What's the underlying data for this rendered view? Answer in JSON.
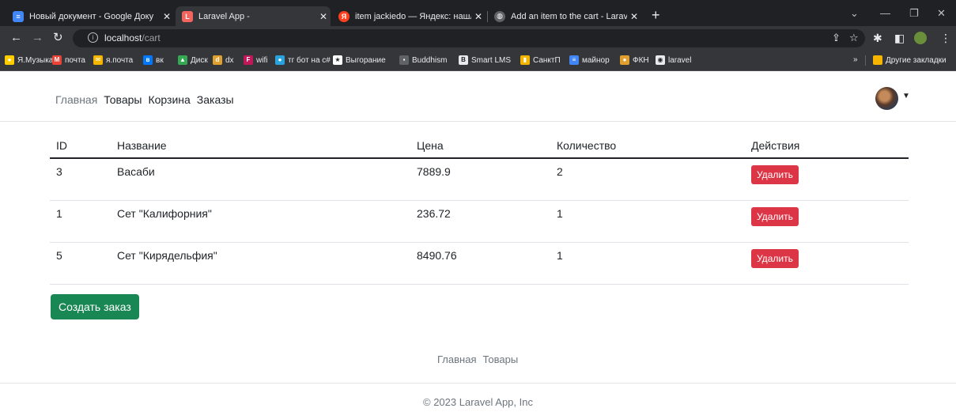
{
  "browser": {
    "tabs": [
      {
        "title": "Новый документ - Google Доку",
        "icon": "docs-icon",
        "color": "#4285f4",
        "glyph": "≡"
      },
      {
        "title": "Laravel App -",
        "icon": "laravel-icon",
        "color": "#f4645f",
        "glyph": "L"
      },
      {
        "title": "item jackiedo — Яндекс: нашло",
        "icon": "yandex-icon",
        "color": "#fc3f1d",
        "glyph": "Я"
      },
      {
        "title": "Add an item to the cart - Laravel",
        "icon": "globe-icon",
        "color": "#5f6368",
        "glyph": "◍"
      }
    ],
    "url_host": "localhost",
    "url_path": "/cart",
    "bookmarks": [
      {
        "label": "Я.Музыка",
        "color": "#ffcc00",
        "glyph": "●"
      },
      {
        "label": "почта",
        "color": "#ea4335",
        "glyph": "M"
      },
      {
        "label": "я.почта",
        "color": "#f4b400",
        "glyph": "✉"
      },
      {
        "label": "вк",
        "color": "#0077ff",
        "glyph": "в"
      },
      {
        "label": "Диск",
        "color": "#34a853",
        "glyph": "▲"
      },
      {
        "label": "dx",
        "color": "#e0a030",
        "glyph": "d"
      },
      {
        "label": "wifi",
        "color": "#c2185b",
        "glyph": "F"
      },
      {
        "label": "тг бот на c#",
        "color": "#2aa3dc",
        "glyph": "●"
      },
      {
        "label": "Выгорание",
        "color": "#ffffff",
        "glyph": "★"
      },
      {
        "label": "Buddhism",
        "color": "#5f6368",
        "glyph": "▪"
      },
      {
        "label": "Smart LMS",
        "color": "#e8eaed",
        "glyph": "B"
      },
      {
        "label": "СанктП",
        "color": "#f4b400",
        "glyph": "▮"
      },
      {
        "label": "майнор",
        "color": "#4285f4",
        "glyph": "≡"
      },
      {
        "label": "ФКН",
        "color": "#e0a030",
        "glyph": "●"
      },
      {
        "label": "laravel",
        "color": "#e8eaed",
        "glyph": "◉"
      }
    ],
    "other_bookmarks": "Другие закладки"
  },
  "nav": {
    "items": [
      "Главная",
      "Товары",
      "Корзина",
      "Заказы"
    ]
  },
  "table": {
    "headers": [
      "ID",
      "Название",
      "Цена",
      "Количество",
      "Действия"
    ],
    "rows": [
      {
        "id": "3",
        "name": "Васаби",
        "price": "7889.9",
        "qty": "2",
        "action": "Удалить"
      },
      {
        "id": "1",
        "name": "Сет \"Калифорния\"",
        "price": "236.72",
        "qty": "1",
        "action": "Удалить"
      },
      {
        "id": "5",
        "name": "Сет \"Кирядельфия\"",
        "price": "8490.76",
        "qty": "1",
        "action": "Удалить"
      }
    ]
  },
  "create_order_label": "Создать заказ",
  "footer": {
    "links": [
      "Главная",
      "Товары"
    ],
    "copyright": "© 2023 Laravel App, Inc"
  }
}
